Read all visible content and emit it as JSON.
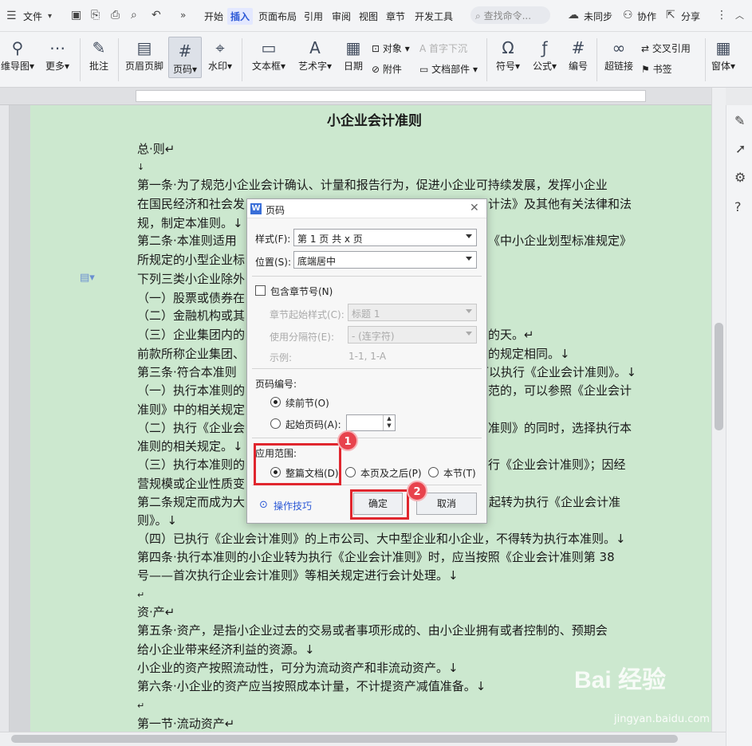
{
  "menubar": {
    "file": "文件",
    "tabs": [
      "开始",
      "插入",
      "页面布局",
      "引用",
      "审阅",
      "视图",
      "章节",
      "开发工具"
    ],
    "active_tab": "插入",
    "search_placeholder": "查找命令...",
    "sync": "未同步",
    "collab": "协作",
    "share": "分享"
  },
  "ribbon": {
    "mindmap": "维导图",
    "more": "更多",
    "comment": "批注",
    "header_footer": "页眉页脚",
    "page_number": "页码",
    "watermark": "水印",
    "textbox": "文本框",
    "wordart": "艺术字",
    "date": "日期",
    "object": "对象",
    "attachment": "附件",
    "dropcap": "首字下沉",
    "docpart": "文档部件",
    "symbol": "符号",
    "formula": "公式",
    "numbering": "编号",
    "hyperlink": "超链接",
    "crossref": "交叉引用",
    "bookmark": "书签",
    "window": "窗体"
  },
  "document": {
    "title": "小企业会计准则",
    "lines": [
      "总·则↵",
      "↓",
      "第一条·为了规范小企业会计确认、计量和报告行为，促进小企业可持续发展，发挥小企业",
      "在国民经济和社会发",
      "计法》及其他有关法律和法",
      "规，制定本准则。↓",
      "第二条·本准则适用",
      "《中小企业划型标准规定》",
      "所规定的小型企业标",
      "下列三类小企业除外",
      "（一）股票或债券在",
      "（二）金融机构或其",
      "（三）企业集团内的",
      "的天。↵",
      "前款所称企业集团、",
      "的规定相同。↓",
      "第三条·符合本准则",
      "可以执行《企业会计准则》。↓",
      "（一）执行本准则的",
      "范的，可以参照《企业会计",
      "准则》中的相关规定",
      "（二）执行《企业会",
      "准则》的同时，选择执行本",
      "准则的相关规定。↓",
      "（三）执行本准则的",
      "行《企业会计准则》；因经",
      "营规模或企业性质变",
      "第二条规定而成为大",
      "日起转为执行《企业会计准",
      "则》。↓",
      "（四）已执行《企业会计准则》的上市公司、大中型企业和小企业，不得转为执行本准则。↓",
      "第四条·执行本准则的小企业转为执行《企业会计准则》时，应当按照《企业会计准则第 38",
      "号——首次执行企业会计准则》等相关规定进行会计处理。↓",
      "↵",
      "资·产↵",
      "第五条·资产，是指小企业过去的交易或者事项形成的、由小企业拥有或者控制的、预期会",
      "给小企业带来经济利益的资源。↓",
      "小企业的资产按照流动性，可分为流动资产和非流动资产。↓",
      "第六条·小企业的资产应当按照成本计量，不计提资产减值准备。↓",
      "↵",
      "第一节·流动资产↵"
    ]
  },
  "dialog": {
    "title": "页码",
    "style_label": "样式(F):",
    "style_value": "第 1 页 共 x 页",
    "position_label": "位置(S):",
    "position_value": "底端居中",
    "include_chapter": "包含章节号(N)",
    "chapter_style_label": "章节起始样式(C):",
    "chapter_style_value": "标题 1",
    "separator_label": "使用分隔符(E):",
    "separator_value": "-   (连字符)",
    "example_label": "示例:",
    "example_value": "1-1, 1-A",
    "numbering_label": "页码编号:",
    "continue": "续前节(O)",
    "start_at": "起始页码(A):",
    "scope_label": "应用范围:",
    "scope_whole": "整篇文档(D)",
    "scope_after": "本页及之后(P)",
    "scope_section": "本节(T)",
    "tips": "操作技巧",
    "ok": "确定",
    "cancel": "取消"
  },
  "annotations": {
    "step1": "1",
    "step2": "2"
  },
  "watermark": {
    "brand": "Bai 经验",
    "url": "jingyan.baidu.com"
  },
  "colors": {
    "page_bg": "#cce8cf",
    "highlight": "#e0262e",
    "accent": "#2b58d6"
  }
}
